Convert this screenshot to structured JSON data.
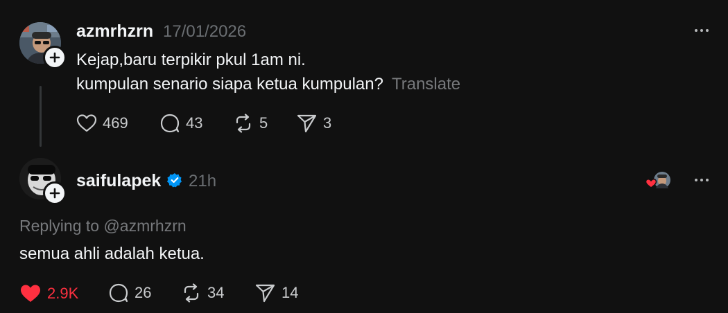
{
  "colors": {
    "background": "#111111",
    "text_primary": "#f3f5f7",
    "text_secondary": "#77797c",
    "like_active": "#ff3040",
    "verified": "#0095f6"
  },
  "post": {
    "author": "azmrhzrn",
    "date": "17/01/2026",
    "line1": "Kejap,baru terpikir pkul 1am ni.",
    "line2": "kumpulan senario siapa ketua kumpulan?",
    "translate_label": "Translate",
    "stats": {
      "likes": "469",
      "comments": "43",
      "reposts": "5",
      "shares": "3"
    }
  },
  "reply": {
    "author": "saifulapek",
    "verified": true,
    "time": "21h",
    "replying_to": "Replying to @azmrhzrn",
    "text": "semua ahli adalah ketua.",
    "stats": {
      "likes": "2.9K",
      "comments": "26",
      "reposts": "34",
      "shares": "14"
    }
  },
  "icons": {
    "like": "heart-icon",
    "comment": "comment-bubble-icon",
    "repost": "repost-icon",
    "share": "send-icon",
    "more": "more-dots-icon",
    "follow": "plus-icon"
  }
}
